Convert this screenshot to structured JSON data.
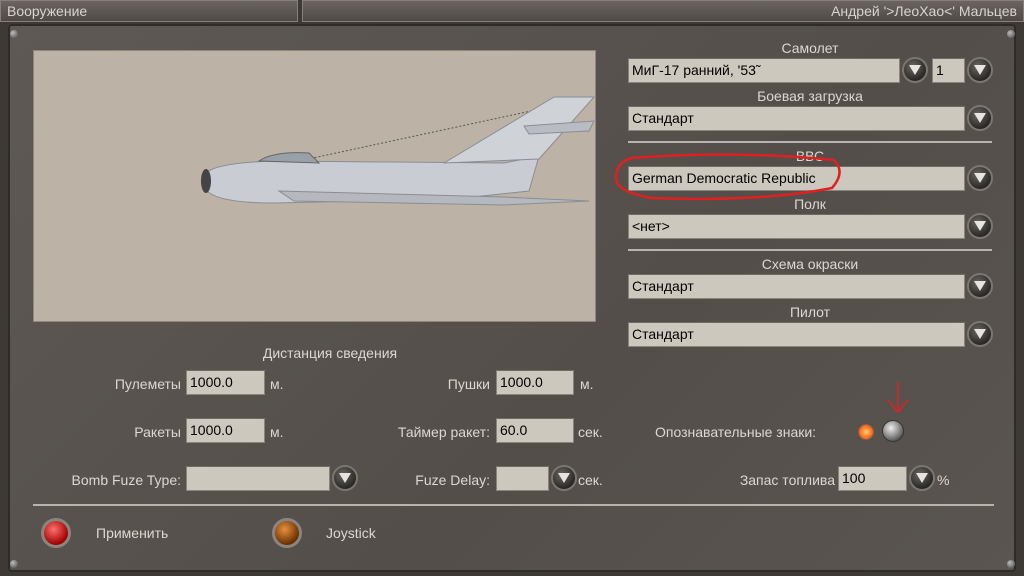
{
  "header": {
    "section_title": "Вооружение",
    "pilot_name": "Андрей '>ЛеоХао<' Мальцев"
  },
  "aircraft": {
    "plane_label": "Самолет",
    "plane_value": "МиГ-17 ранний, '53˜",
    "count_value": "1",
    "loadout_label": "Боевая загрузка",
    "loadout_value": "Стандарт",
    "airforce_label": "ВВС",
    "airforce_value": "German Democratic Republic",
    "regiment_label": "Полк",
    "regiment_value": "<нет>",
    "skin_label": "Схема окраски",
    "skin_value": "Стандарт",
    "pilot_label": "Пилот",
    "pilot_value": "Стандарт"
  },
  "convergence": {
    "title": "Дистанция сведения",
    "mg_label": "Пулеметы",
    "mg_value": "1000.0",
    "mg_unit": "м.",
    "cannon_label": "Пушки",
    "cannon_value": "1000.0",
    "cannon_unit": "м.",
    "rockets_label": "Ракеты",
    "rockets_value": "1000.0",
    "rockets_unit": "м.",
    "rocket_timer_label": "Таймер ракет:",
    "rocket_timer_value": "60.0",
    "rocket_timer_unit": "сек.",
    "bomb_fuze_label": "Bomb Fuze Type:",
    "bomb_fuze_value": "",
    "fuze_delay_label": "Fuze Delay:",
    "fuze_delay_value": "",
    "fuze_delay_unit": "сек.",
    "markings_label": "Опознавательные знаки:",
    "fuel_label": "Запас топлива",
    "fuel_value": "100",
    "fuel_unit": "%"
  },
  "actions": {
    "apply_label": "Применить",
    "joystick_label": "Joystick"
  },
  "colors": {
    "annotation": "#e02020"
  }
}
